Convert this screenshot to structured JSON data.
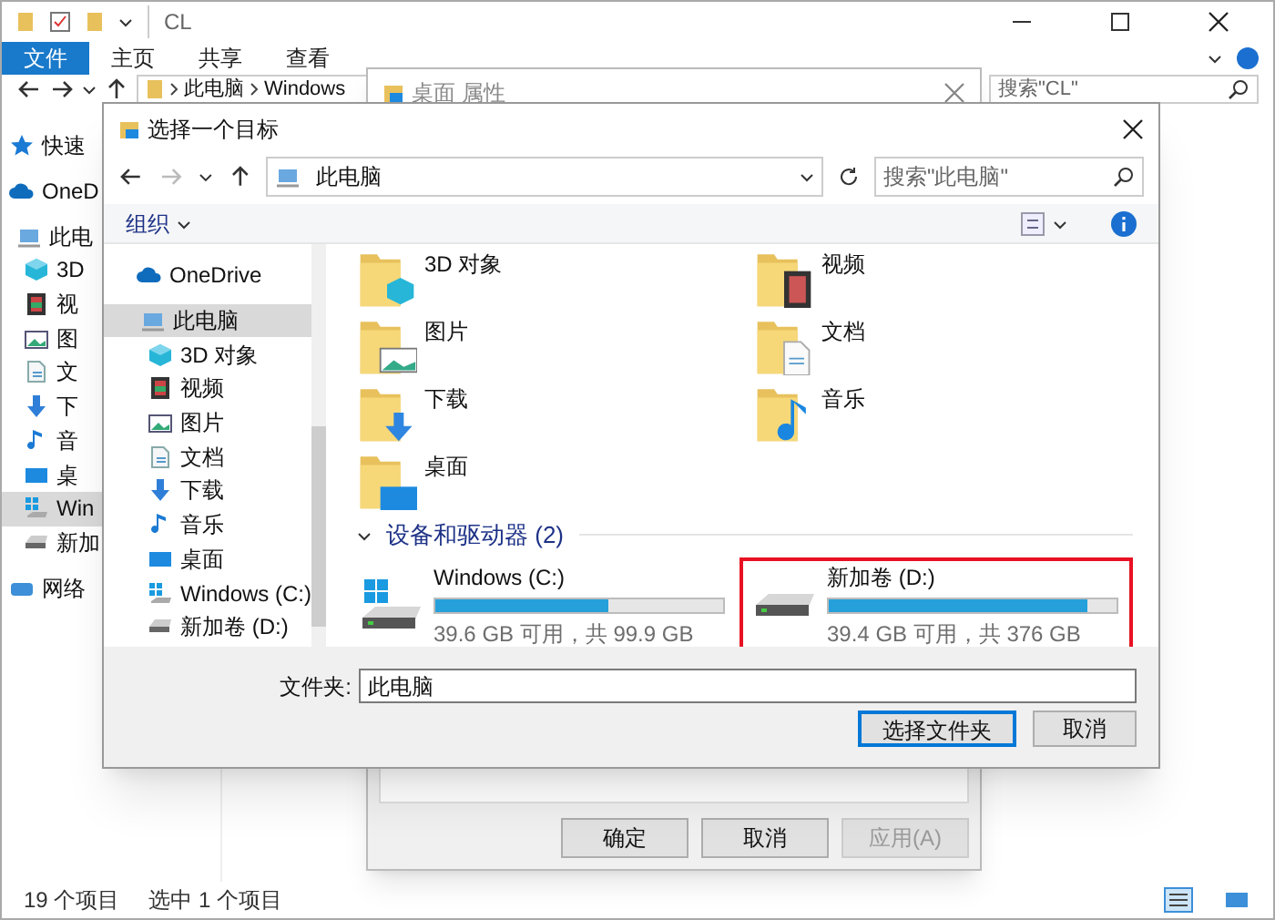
{
  "explorer": {
    "title": "CL",
    "ribbon_tabs": [
      {
        "label": "文件",
        "selected": true
      },
      {
        "label": "主页",
        "selected": false
      },
      {
        "label": "共享",
        "selected": false
      },
      {
        "label": "查看",
        "selected": false
      }
    ],
    "path": [
      "此电脑",
      "Windows"
    ],
    "search": {
      "placeholder": "搜索\"CL\""
    },
    "sidebar": [
      {
        "label": "快速",
        "kind": "star",
        "selected": false
      },
      {
        "label": "OneD",
        "kind": "cloud",
        "selected": false
      },
      {
        "label": "此电",
        "kind": "pc",
        "selected": false
      },
      {
        "label": "3D",
        "kind": "cube",
        "selected": false
      },
      {
        "label": "视",
        "kind": "film",
        "selected": false
      },
      {
        "label": "图",
        "kind": "picture",
        "selected": false
      },
      {
        "label": "文",
        "kind": "doc",
        "selected": false
      },
      {
        "label": "下",
        "kind": "download",
        "selected": false
      },
      {
        "label": "音",
        "kind": "music",
        "selected": false
      },
      {
        "label": "桌",
        "kind": "desktop",
        "selected": false
      },
      {
        "label": "Win",
        "kind": "windrive",
        "selected": true
      },
      {
        "label": "新加",
        "kind": "drive",
        "selected": false
      },
      {
        "label": "网络",
        "kind": "network",
        "selected": false
      }
    ],
    "status_bar": [
      "19 个项目",
      "选中 1 个项目"
    ]
  },
  "properties_dialog": {
    "title": "桌面 属性",
    "buttons": [
      {
        "label": "确定",
        "disabled": false
      },
      {
        "label": "取消",
        "disabled": false
      },
      {
        "label": "应用(A)",
        "disabled": true
      }
    ]
  },
  "picker": {
    "title": "选择一个目标",
    "path": [
      "此电脑"
    ],
    "search": {
      "placeholder": "搜索\"此电脑\""
    },
    "organize": "组织",
    "tree": [
      {
        "label": "OneDrive",
        "kind": "cloud",
        "selected": false
      },
      {
        "label": "此电脑",
        "kind": "pc",
        "selected": true
      },
      {
        "label": "3D 对象",
        "kind": "cube",
        "selected": false
      },
      {
        "label": "视频",
        "kind": "film",
        "selected": false
      },
      {
        "label": "图片",
        "kind": "picture",
        "selected": false
      },
      {
        "label": "文档",
        "kind": "doc",
        "selected": false
      },
      {
        "label": "下载",
        "kind": "download",
        "selected": false
      },
      {
        "label": "音乐",
        "kind": "music",
        "selected": false
      },
      {
        "label": "桌面",
        "kind": "desktop",
        "selected": false
      },
      {
        "label": "Windows (C:)",
        "kind": "windrive",
        "selected": false
      },
      {
        "label": "新加卷 (D:)",
        "kind": "drive",
        "selected": false
      }
    ],
    "folders": [
      {
        "label": "3D 对象",
        "kind": "cube"
      },
      {
        "label": "视频",
        "kind": "film"
      },
      {
        "label": "图片",
        "kind": "picture"
      },
      {
        "label": "文档",
        "kind": "doc"
      },
      {
        "label": "下载",
        "kind": "download"
      },
      {
        "label": "音乐",
        "kind": "music"
      },
      {
        "label": "桌面",
        "kind": "desktop"
      }
    ],
    "drives_group": "设备和驱动器 (2)",
    "drives": [
      {
        "name": "Windows (C:)",
        "kind": "windrive",
        "level": 0.6,
        "detail": "39.6 GB 可用，共 99.9 GB",
        "highlighted": false
      },
      {
        "name": "新加卷 (D:)",
        "kind": "drive",
        "level": 0.9,
        "detail": "39.4 GB 可用，共 376 GB",
        "highlighted": true
      }
    ],
    "folder_field": {
      "label": "文件夹:",
      "value": "此电脑"
    },
    "buttons": [
      {
        "label": "选择文件夹",
        "default": true
      },
      {
        "label": "取消",
        "default": false
      }
    ]
  }
}
